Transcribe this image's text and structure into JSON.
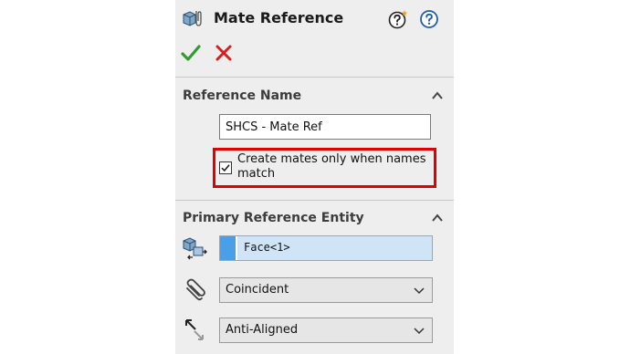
{
  "title": "Mate Reference",
  "sections": {
    "reference_name": {
      "title": "Reference Name",
      "input_value": "SHCS - Mate Ref",
      "checkbox_label": "Create mates only when names match",
      "checkbox_checked": true
    },
    "primary_entity": {
      "title": "Primary Reference Entity",
      "selection": "Face<1>",
      "mate_type": "Coincident",
      "alignment": "Anti-Aligned"
    }
  },
  "colors": {
    "accept": "#2e9d2e",
    "cancel": "#d62020",
    "highlight": "#e00000",
    "selection_bg": "#cfe4f7",
    "selection_swatch": "#4aa0e8"
  },
  "icons": {
    "title": "mate-reference-icon",
    "whats_new": "whats-new-help-icon",
    "help": "help-icon",
    "accept": "checkmark-icon",
    "cancel": "close-icon",
    "collapse": "chevron-up-icon",
    "entity": "reference-entity-icon",
    "mate_type": "paperclip-icon",
    "alignment": "alignment-arrow-icon"
  }
}
